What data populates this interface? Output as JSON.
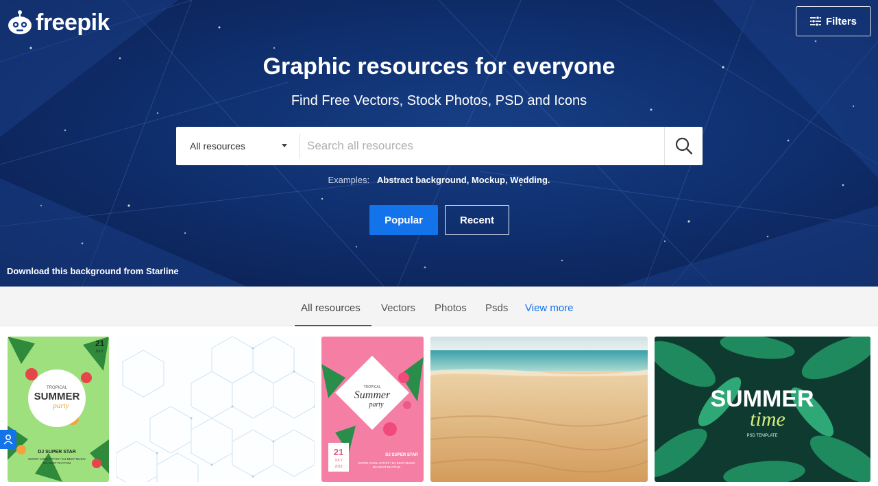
{
  "header": {
    "logo_text": "freepik",
    "filters_label": "Filters"
  },
  "hero": {
    "title": "Graphic resources for everyone",
    "subtitle": "Find Free Vectors, Stock Photos, PSD and Icons",
    "examples_label": "Examples:",
    "examples_links": "Abstract background, Mockup, Wedding.",
    "popular_label": "Popular",
    "recent_label": "Recent",
    "credit": "Download this background from Starline"
  },
  "search": {
    "category": "All resources",
    "placeholder": "Search all resources"
  },
  "tabs": [
    {
      "label": "All resources",
      "active": true
    },
    {
      "label": "Vectors"
    },
    {
      "label": "Photos"
    },
    {
      "label": "Psds"
    },
    {
      "label": "View more"
    }
  ],
  "thumbnails": {
    "t1": {
      "line1": "TROPICAL",
      "line2": "SUMMER",
      "line3": "party",
      "date_day": "21",
      "date_month": "JULY",
      "star": "DJ SUPER STAR",
      "caption": "SUPER COOL ARTIST / DJ BEST MUSIC",
      "caption2": "MC BEST RHYTHM"
    },
    "t3": {
      "line1": "TROPICAL",
      "line2": "Summer",
      "line3": "party",
      "date_day": "21",
      "date_month": "JULY",
      "date_year": "2019",
      "star": "DJ SUPER STAR",
      "caption": "SUPER COOL ARTIST / DJ BEST MUSIC",
      "caption2": "MC BEST RHYTHM"
    },
    "t5": {
      "line1": "SUMMER",
      "line2": "time",
      "caption": "PSD TEMPLATE"
    }
  },
  "colors": {
    "accent": "#1273eb",
    "hero_dark": "#0b1d4d",
    "hero_mid": "#173f86"
  }
}
